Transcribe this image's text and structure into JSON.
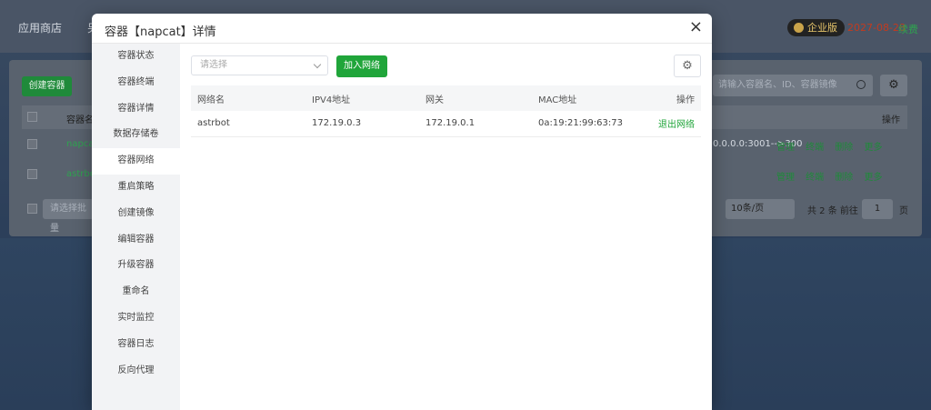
{
  "background": {
    "nav_tabs": [
      "应用商店",
      "另"
    ],
    "badge": "企业版",
    "date": "2027-08-28",
    "renew": "续费",
    "create_button": "创建容器",
    "search_placeholder": "请输入容器名、ID、容器镜像",
    "table_header_name": "容器名",
    "table_header_ops": "操作",
    "rows": [
      {
        "name": "napcat",
        "ports": "0.0.0.0:3001-->300",
        "ops": "管理 终端 删除 更多"
      },
      {
        "name": "astrbot",
        "ports": "",
        "ops": "管理 终端 删除 更多"
      }
    ],
    "batch_placeholder": "请选择批量",
    "per_page": "10条/页",
    "total": "共 2 条  前往",
    "page": "1",
    "page_unit": "页"
  },
  "modal": {
    "title": "容器【napcat】详情",
    "close_icon": "×",
    "sidebar": [
      {
        "label": "容器状态",
        "active": false
      },
      {
        "label": "容器终端",
        "active": false
      },
      {
        "label": "容器详情",
        "active": false
      },
      {
        "label": "数据存储卷",
        "active": false
      },
      {
        "label": "容器网络",
        "active": true
      },
      {
        "label": "重启策略",
        "active": false
      },
      {
        "label": "创建镜像",
        "active": false
      },
      {
        "label": "编辑容器",
        "active": false
      },
      {
        "label": "升级容器",
        "active": false
      },
      {
        "label": "重命名",
        "active": false
      },
      {
        "label": "实时监控",
        "active": false
      },
      {
        "label": "容器日志",
        "active": false
      },
      {
        "label": "反向代理",
        "active": false
      }
    ],
    "network_select_placeholder": "请选择",
    "join_button": "加入网络",
    "gear_icon": "⚙",
    "table": {
      "headers": [
        "网络名",
        "IPV4地址",
        "网关",
        "MAC地址",
        "操作"
      ],
      "rows": [
        {
          "name": "astrbot",
          "ipv4": "172.19.0.3",
          "gateway": "172.19.0.1",
          "mac": "0a:19:21:99:63:73",
          "action": "退出网络"
        }
      ]
    }
  },
  "colors": {
    "accent_green": "#20a53a",
    "sidebar_bg": "#f2f3f5"
  }
}
